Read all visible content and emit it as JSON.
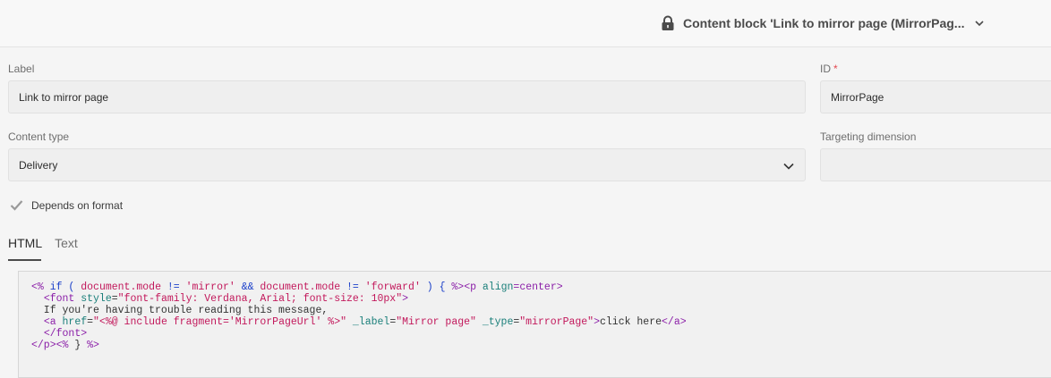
{
  "header": {
    "title": "Content block 'Link to mirror page (MirrorPag...",
    "lock_icon": "lock-icon",
    "chevron_icon": "chevron-down-icon"
  },
  "form": {
    "label": {
      "caption": "Label",
      "value": "Link to mirror page"
    },
    "id": {
      "caption": "ID",
      "required_marker": "*",
      "value": "MirrorPage"
    },
    "content_type": {
      "caption": "Content type",
      "value": "Delivery"
    },
    "targeting_dimension": {
      "caption": "Targeting dimension",
      "value": ""
    },
    "depends_on_format": {
      "caption": "Depends on format",
      "checked": true
    }
  },
  "tabs": [
    {
      "label": "HTML",
      "active": true
    },
    {
      "label": "Text",
      "active": false
    }
  ],
  "editor": {
    "lines": [
      {
        "tokens": [
          {
            "t": "<%",
            "c": "delim"
          },
          {
            "t": " ",
            "c": ""
          },
          {
            "t": "if",
            "c": "kw"
          },
          {
            "t": " ( ",
            "c": "kw"
          },
          {
            "t": "document.mode",
            "c": "str"
          },
          {
            "t": " != ",
            "c": "kw"
          },
          {
            "t": "'mirror'",
            "c": "str"
          },
          {
            "t": " && ",
            "c": "kw"
          },
          {
            "t": "document.mode",
            "c": "str"
          },
          {
            "t": " != ",
            "c": "kw"
          },
          {
            "t": "'forward'",
            "c": "str"
          },
          {
            "t": " ) { ",
            "c": "kw"
          },
          {
            "t": "%>",
            "c": "delim"
          },
          {
            "t": "<p",
            "c": "tag"
          },
          {
            "t": " align",
            "c": "attr"
          },
          {
            "t": "=center",
            "c": "tag"
          },
          {
            "t": ">",
            "c": "tag"
          }
        ]
      },
      {
        "tokens": [
          {
            "t": "  ",
            "c": ""
          },
          {
            "t": "<font",
            "c": "tag"
          },
          {
            "t": " style",
            "c": "attr"
          },
          {
            "t": "=",
            "c": ""
          },
          {
            "t": "\"font-family: Verdana, Arial; font-size: 10px\"",
            "c": "str"
          },
          {
            "t": ">",
            "c": "tag"
          }
        ]
      },
      {
        "tokens": [
          {
            "t": "  If you're having trouble reading this message,",
            "c": ""
          }
        ]
      },
      {
        "tokens": [
          {
            "t": "  ",
            "c": ""
          },
          {
            "t": "<a",
            "c": "tag"
          },
          {
            "t": " href",
            "c": "attr"
          },
          {
            "t": "=",
            "c": ""
          },
          {
            "t": "\"<%@ include fragment='MirrorPageUrl' %>\"",
            "c": "str"
          },
          {
            "t": " _label",
            "c": "attr"
          },
          {
            "t": "=",
            "c": ""
          },
          {
            "t": "\"Mirror page\"",
            "c": "str"
          },
          {
            "t": " _type",
            "c": "attr"
          },
          {
            "t": "=",
            "c": ""
          },
          {
            "t": "\"mirrorPage\"",
            "c": "str"
          },
          {
            "t": ">",
            "c": "tag"
          },
          {
            "t": "click here",
            "c": ""
          },
          {
            "t": "</a>",
            "c": "tag"
          }
        ]
      },
      {
        "tokens": [
          {
            "t": "  ",
            "c": ""
          },
          {
            "t": "</font>",
            "c": "tag"
          }
        ]
      },
      {
        "tokens": [
          {
            "t": "</p>",
            "c": "tag"
          },
          {
            "t": "<%",
            "c": "delim"
          },
          {
            "t": " } ",
            "c": ""
          },
          {
            "t": "%>",
            "c": "delim"
          }
        ]
      }
    ]
  }
}
